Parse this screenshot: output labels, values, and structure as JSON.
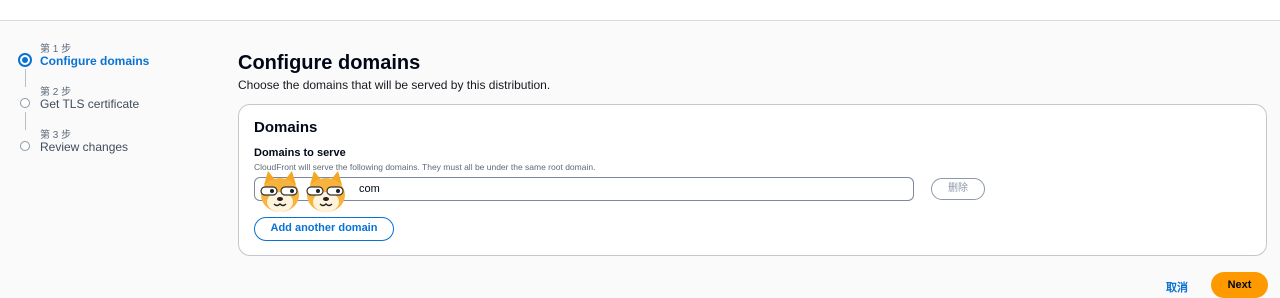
{
  "steps": [
    {
      "number": "第 1 步",
      "title": "Configure domains",
      "active": true
    },
    {
      "number": "第 2 步",
      "title": "Get TLS certificate",
      "active": false
    },
    {
      "number": "第 3 步",
      "title": "Review changes",
      "active": false
    }
  ],
  "main": {
    "title": "Configure domains",
    "description": "Choose the domains that will be served by this distribution."
  },
  "card": {
    "title": "Domains",
    "field_label": "Domains to serve",
    "field_description": "CloudFront will serve the following domains. They must all be under the same root domain.",
    "domain_value": "com",
    "remove_label": "删除",
    "add_label": "Add another domain"
  },
  "footer": {
    "cancel_label": "取消",
    "next_label": "Next"
  },
  "colors": {
    "accent": "#0972d3",
    "primary_button": "#ff9900"
  },
  "icons": [
    "dog-emoji-icon"
  ]
}
